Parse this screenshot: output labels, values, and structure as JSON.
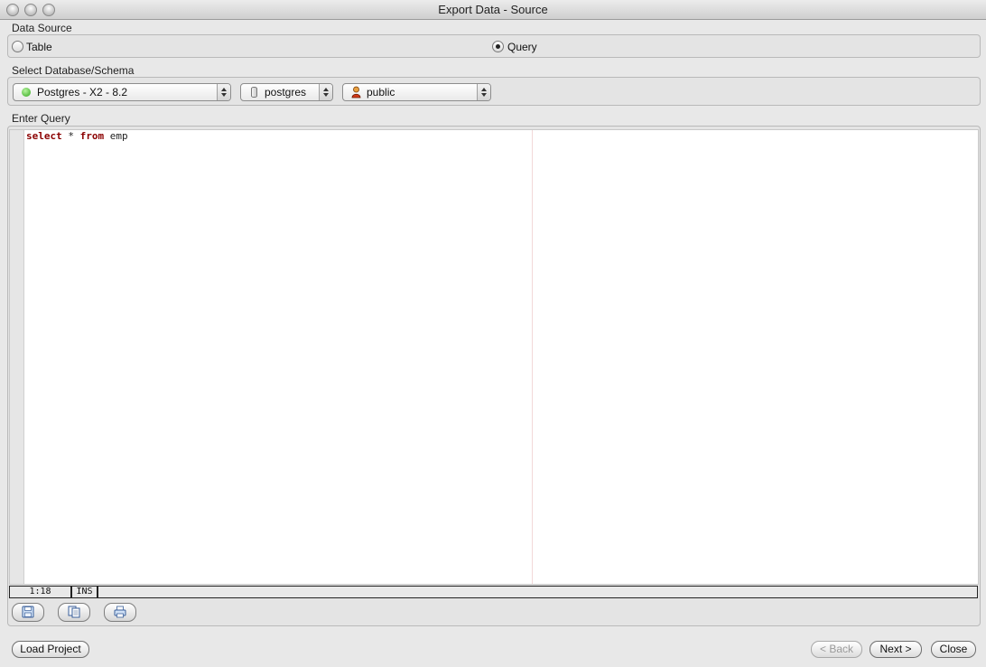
{
  "window": {
    "title": "Export Data - Source"
  },
  "data_source": {
    "label": "Data Source",
    "options": [
      {
        "label": "Table",
        "selected": false
      },
      {
        "label": "Query",
        "selected": true
      }
    ]
  },
  "select_db": {
    "label": "Select Database/Schema",
    "server": {
      "value": "Postgres - X2 - 8.2",
      "icon": "green-status-dot-icon"
    },
    "database": {
      "value": "postgres",
      "icon": "database-cylinder-icon"
    },
    "schema": {
      "value": "public",
      "icon": "user-schema-icon"
    }
  },
  "query": {
    "label": "Enter Query",
    "code_keyword_1": "select",
    "code_rest_1": " * ",
    "code_keyword_2": "from",
    "code_rest_2": " emp"
  },
  "status": {
    "position": "1:18",
    "mode": "INS"
  },
  "toolbar": {
    "icons": [
      "save-icon",
      "copy-icon",
      "print-icon"
    ]
  },
  "buttons": {
    "load_project": "Load Project",
    "back": "< Back",
    "next": "Next >",
    "close": "Close"
  }
}
